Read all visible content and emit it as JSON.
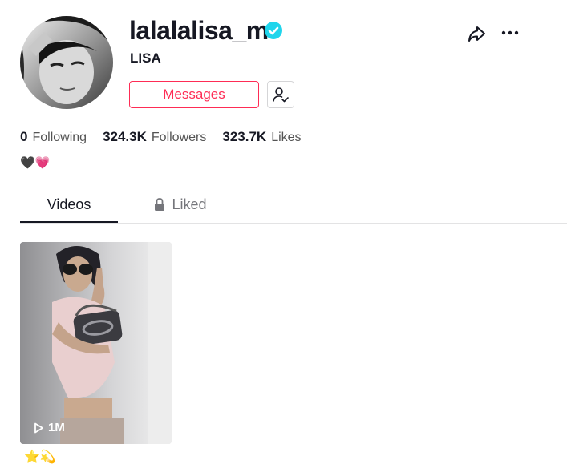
{
  "profile": {
    "username": "lalalalisa_m",
    "nickname": "LISA",
    "verified": true,
    "bio": "🖤💗"
  },
  "actions": {
    "messages_label": "Messages",
    "follow_icon": "user-check-icon",
    "share_icon": "share-arrow-icon",
    "more_icon": "more-dots-icon"
  },
  "stats": {
    "following": {
      "value": "0",
      "label": "Following"
    },
    "followers": {
      "value": "324.3K",
      "label": "Followers"
    },
    "likes": {
      "value": "323.7K",
      "label": "Likes"
    }
  },
  "tabs": [
    {
      "label": "Videos",
      "active": true
    },
    {
      "label": "Liked",
      "active": false,
      "icon": "lock-icon"
    }
  ],
  "videos": [
    {
      "views": "1M",
      "caption": "⭐💫"
    }
  ],
  "colors": {
    "accent": "#fe2c55",
    "verified": "#20d5ec",
    "text": "#161823"
  }
}
